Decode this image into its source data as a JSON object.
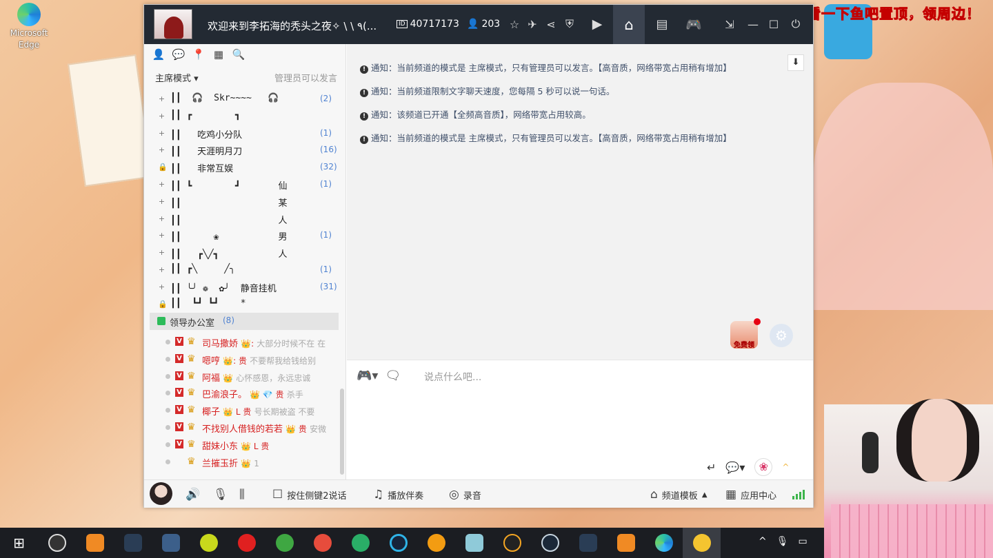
{
  "desktop": {
    "edge_label_1": "Microsoft",
    "edge_label_2": "Edge",
    "promo": "开通了钻粉的宝贝们看一下鱼吧置顶，领周边！"
  },
  "titlebar": {
    "title": "欢迎来到李拓海的秃头之夜✧ \\ \\ ٩(...",
    "channel_id": "40717173",
    "online": "203"
  },
  "left": {
    "mode": "主席模式",
    "mode_hint": "管理员可以发言",
    "channels": [
      {
        "pm": "+",
        "name": "┃┃  🎧  Skr~~~~   🎧",
        "count": "(2)"
      },
      {
        "pm": "+",
        "name": "┃┃ ┏        ┓",
        "count": ""
      },
      {
        "pm": "+",
        "name": "┃┃   吃鸡小分队",
        "count": "(1)"
      },
      {
        "pm": "+",
        "name": "┃┃   天涯明月刀",
        "count": "(16)"
      },
      {
        "pm": "🔒",
        "name": "┃┃   非常互娱",
        "count": "(32)"
      },
      {
        "pm": "+",
        "name": "┃┃ ┗        ┛       仙",
        "count": "(1)"
      },
      {
        "pm": "+",
        "name": "┃┃                  某",
        "count": ""
      },
      {
        "pm": "+",
        "name": "┃┃                  人",
        "count": ""
      },
      {
        "pm": "+",
        "name": "┃┃      ❀           男",
        "count": "(1)"
      },
      {
        "pm": "+",
        "name": "┃┃   ┏╲╱┓           人",
        "count": ""
      },
      {
        "pm": "+",
        "name": "┃┃ ┏╲     ╱╮",
        "count": "(1)"
      },
      {
        "pm": "+",
        "name": "┃┃ ╰╯ ❁  ✿╯  静音挂机",
        "count": "(31)"
      },
      {
        "pm": "🔒",
        "name": "┃┃  ┗┛ ┗┛    *",
        "count": ""
      }
    ],
    "group": {
      "name": "领导办公室",
      "count": "(8)"
    },
    "users": [
      {
        "name": "司马撒娇",
        "badges": "👑:",
        "sig": "大部分时候不在  在"
      },
      {
        "name": "嗯哼",
        "badges": "👑: 贵",
        "sig": "不要帮我给钱给别"
      },
      {
        "name": "阿福",
        "badges": "👑",
        "sig": "心怀感恩，永远忠诚"
      },
      {
        "name": "巴渝浪子。",
        "badges": "👑 💎 贵",
        "sig": "杀手"
      },
      {
        "name": "椰子",
        "badges": "👑 L 贵",
        "sig": "号长期被盗  不要"
      },
      {
        "name": "不找别人借钱的若若",
        "badges": "👑 贵",
        "sig": "安微"
      },
      {
        "name": "甜妹小东",
        "badges": "👑 L 贵",
        "sig": ""
      },
      {
        "name": "兰摧玉折",
        "badges": "👑",
        "sig": "1"
      }
    ]
  },
  "chat": {
    "notices": [
      "通知：当前频道的模式是 主席模式，只有管理员可以发言。【高音质，网络带宽占用稍有增加】",
      "通知：当前频道限制文字聊天速度，您每隔 5 秒可以说一句话。",
      "通知：该频道已开通【全频高音质】，网络带宽占用较高。",
      "通知：当前频道的模式是 主席模式，只有管理员可以发言。【高音质，网络带宽占用稍有增加】"
    ],
    "free_label": "免费领",
    "input_placeholder": "说点什么吧..."
  },
  "bottombar": {
    "ptt": "按住侧键2说话",
    "music": "播放伴奏",
    "record": "录音",
    "template": "频道模板",
    "apps": "应用中心"
  }
}
